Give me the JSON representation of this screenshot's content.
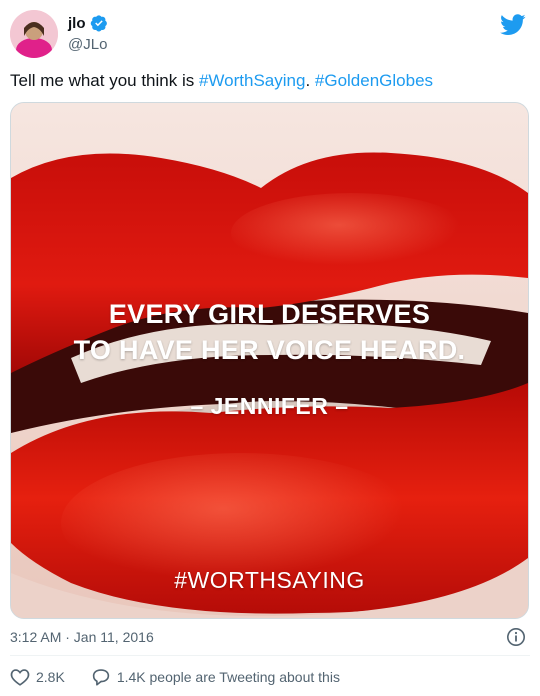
{
  "author": {
    "display_name": "jlo",
    "handle": "@JLo",
    "verified_icon": "verified-badge-icon"
  },
  "tweet": {
    "text_parts": [
      "Tell me what you think is ",
      "#WorthSaying",
      ". ",
      "#GoldenGlobes"
    ]
  },
  "image": {
    "quote_line1": "EVERY GIRL DESERVES",
    "quote_line2": "TO HAVE HER VOICE HEARD.",
    "quote_author": "– JENNIFER –",
    "hashtag": "#WORTHSAYING"
  },
  "meta": {
    "timestamp": "3:12 AM · Jan 11, 2016"
  },
  "actions": {
    "likes": "2.8K",
    "conversation": "1.4K people are Tweeting about this"
  },
  "colors": {
    "link": "#1d9bf0",
    "like": "#f91880",
    "lips": "#d8120c"
  }
}
